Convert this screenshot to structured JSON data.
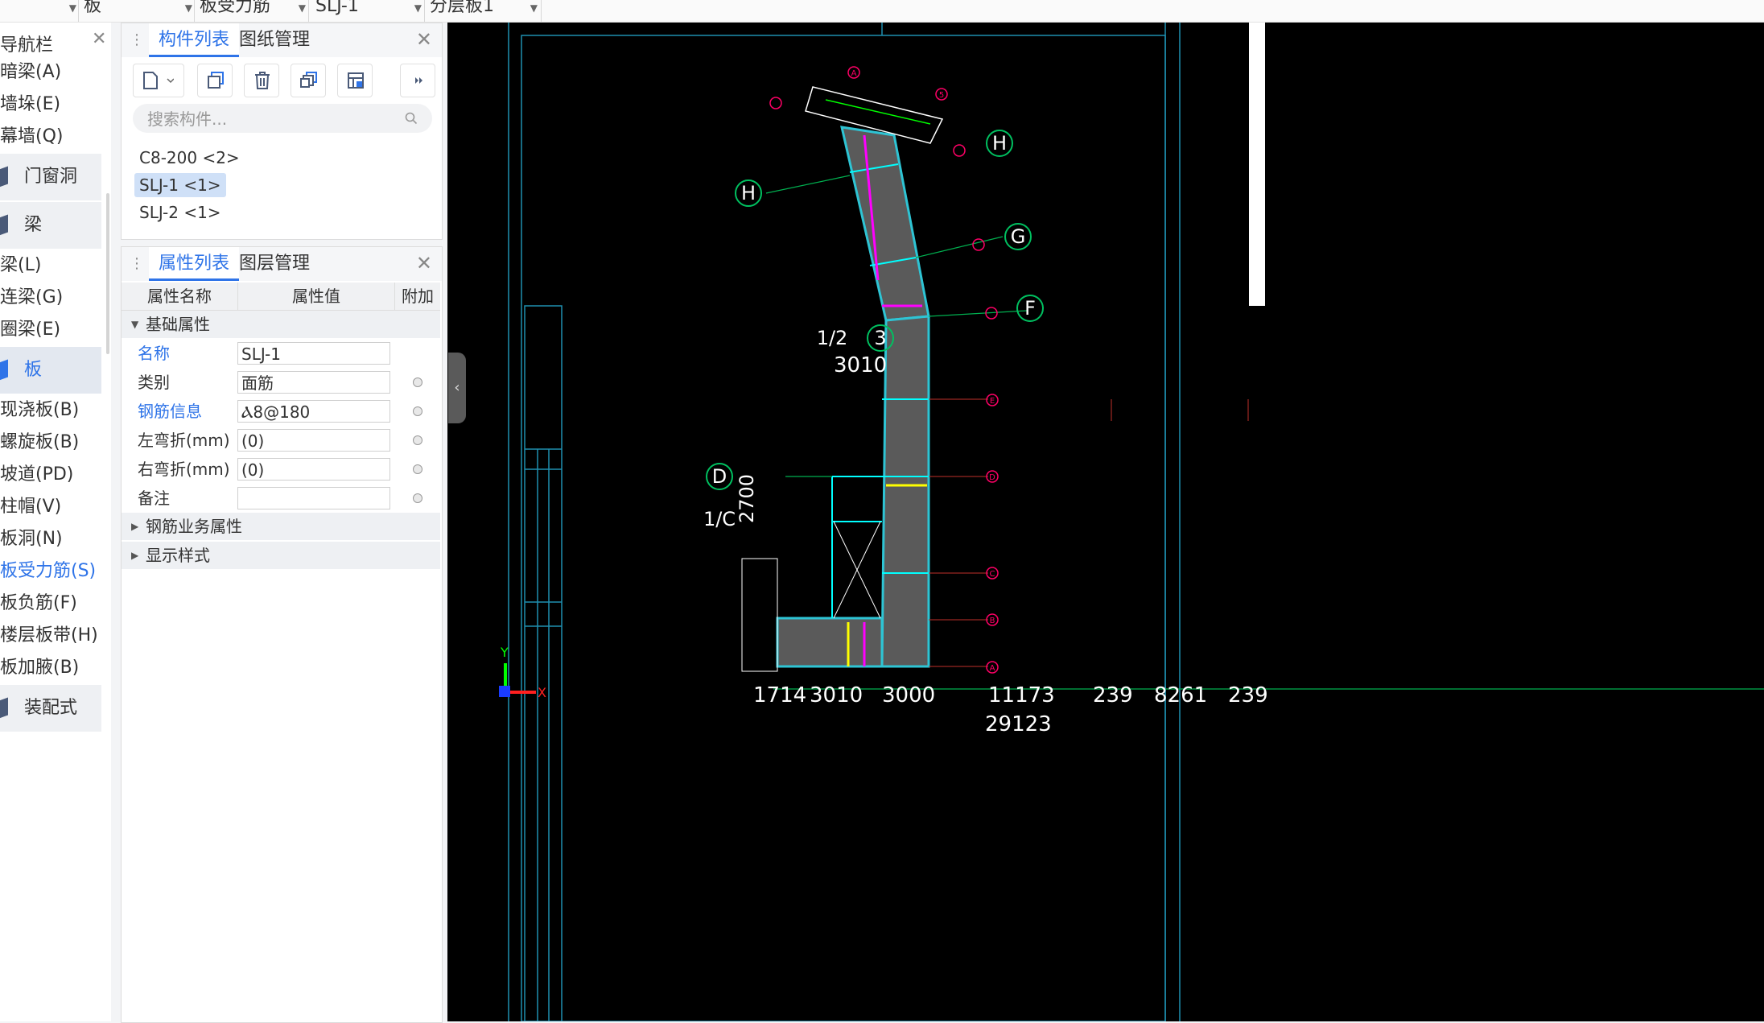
{
  "topbar": {
    "dropdowns": [
      "板",
      "板受力筋",
      "SLJ-1",
      "分层板1"
    ]
  },
  "nav": {
    "title": "导航栏",
    "items": [
      {
        "label": "暗梁(A)",
        "kind": "item"
      },
      {
        "label": "墙垛(E)",
        "kind": "item"
      },
      {
        "label": "幕墙(Q)",
        "kind": "item"
      },
      {
        "label": "门窗洞",
        "kind": "cat"
      },
      {
        "label": "梁",
        "kind": "cat"
      },
      {
        "label": "梁(L)",
        "kind": "item"
      },
      {
        "label": "连梁(G)",
        "kind": "item"
      },
      {
        "label": "圈梁(E)",
        "kind": "item"
      },
      {
        "label": "板",
        "kind": "cat-active"
      },
      {
        "label": "现浇板(B)",
        "kind": "item"
      },
      {
        "label": "螺旋板(B)",
        "kind": "item"
      },
      {
        "label": "坡道(PD)",
        "kind": "item"
      },
      {
        "label": "柱帽(V)",
        "kind": "item"
      },
      {
        "label": "板洞(N)",
        "kind": "item"
      },
      {
        "label": "板受力筋(S)",
        "kind": "item-active"
      },
      {
        "label": "板负筋(F)",
        "kind": "item"
      },
      {
        "label": "楼层板带(H)",
        "kind": "item"
      },
      {
        "label": "板加腋(B)",
        "kind": "item"
      },
      {
        "label": "装配式",
        "kind": "cat"
      }
    ]
  },
  "components_panel": {
    "tabs": [
      "构件列表",
      "图纸管理"
    ],
    "search_placeholder": "搜索构件...",
    "items": [
      "C8-200 <2>",
      "SLJ-1 <1>",
      "SLJ-2 <1>"
    ],
    "selected_index": 1
  },
  "properties_panel": {
    "tabs": [
      "属性列表",
      "图层管理"
    ],
    "columns": [
      "属性名称",
      "属性值",
      "附加"
    ],
    "group_basic": "基础属性",
    "rows": [
      {
        "name": "名称",
        "value": "SLJ-1"
      },
      {
        "name": "类别",
        "value": "面筋"
      },
      {
        "name": "钢筋信息",
        "value": "Ⲁ8@180"
      },
      {
        "name": "左弯折(mm)",
        "value": "(0)"
      },
      {
        "name": "右弯折(mm)",
        "value": "(0)"
      },
      {
        "name": "备注",
        "value": ""
      }
    ],
    "group_rebar": "钢筋业务属性",
    "group_display": "显示样式"
  },
  "drawing": {
    "axis_labels": [
      "A",
      "5",
      "H",
      "H",
      "G",
      "F",
      "E",
      "D",
      "C",
      "B",
      "A",
      "D",
      "1/C",
      "3",
      "1/2"
    ],
    "dims_bottom": [
      "1714",
      "3010",
      "3000",
      "11173",
      "239",
      "8261",
      "239",
      "29123"
    ],
    "dim_left": "3010",
    "dim_vertical": "2700"
  }
}
